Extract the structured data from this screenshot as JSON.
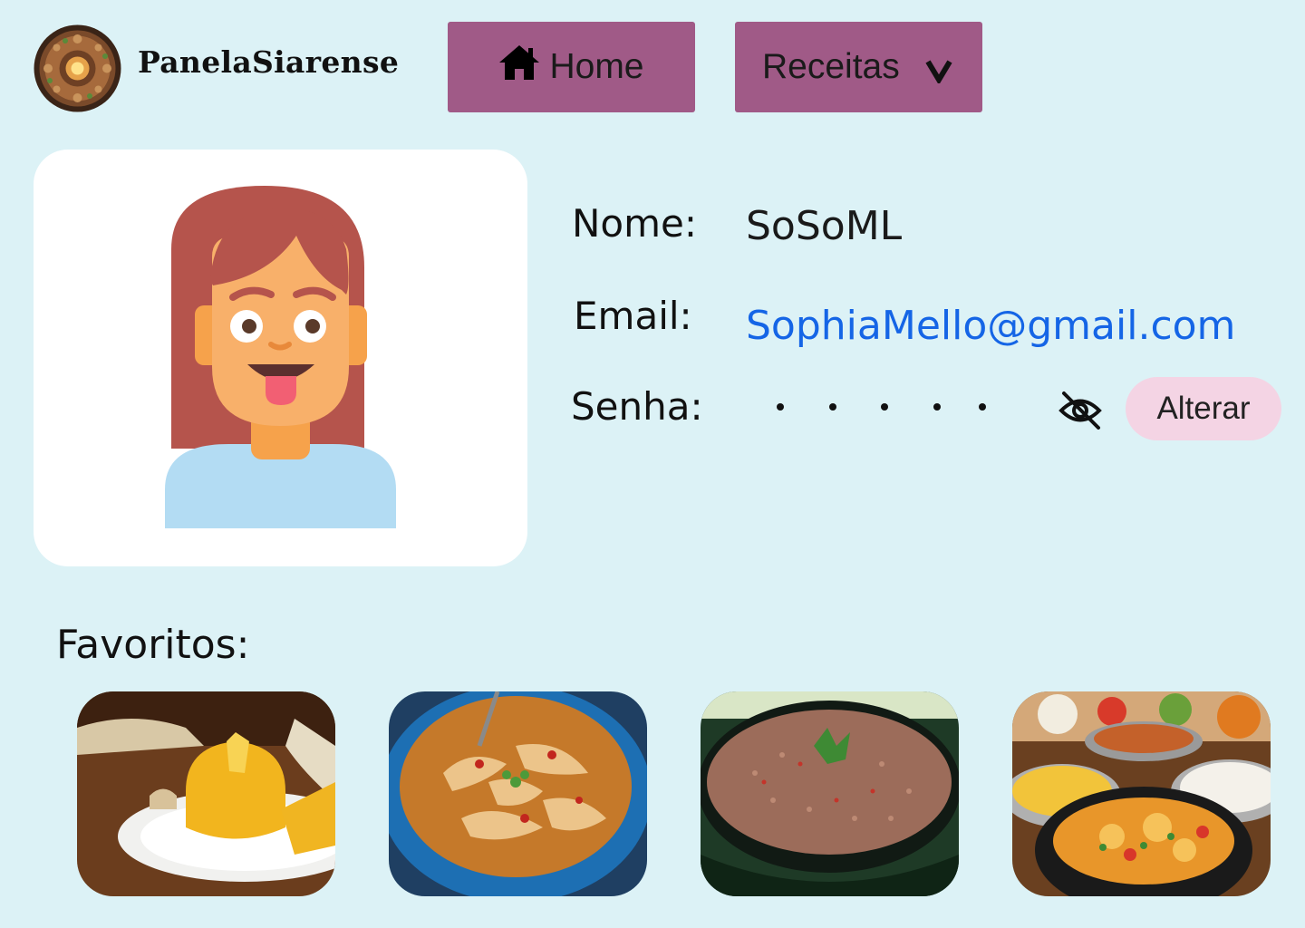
{
  "header": {
    "brand_name": "PanelaSiarense",
    "logo_icon": "mandala-plate-logo",
    "nav": {
      "home_label": "Home",
      "home_icon": "home-icon",
      "receitas_label": "Receitas",
      "receitas_chevron": "v"
    },
    "nav_color": "#a05a87"
  },
  "profile": {
    "avatar_icon": "girl-tongue-out-avatar",
    "nome_label": "Nome:",
    "nome_value": "SoSoML",
    "email_label": "Email:",
    "email_value": "SophiaMello@gmail.com",
    "senha_label": "Senha:",
    "senha_mask": "• • • • •",
    "senha_toggle_icon": "eye-slash-icon",
    "alterar_label": "Alterar"
  },
  "favorites": {
    "title": "Favoritos:",
    "items": [
      {
        "image": "yellow-couscous-cake-photo"
      },
      {
        "image": "tripe-stew-bowl-photo"
      },
      {
        "image": "farofa-pan-photo"
      },
      {
        "image": "fish-moqueca-pot-photo"
      }
    ]
  },
  "colors": {
    "background": "#dcf2f6",
    "link": "#1565e6",
    "alterar_bg": "#f4d4e4"
  }
}
